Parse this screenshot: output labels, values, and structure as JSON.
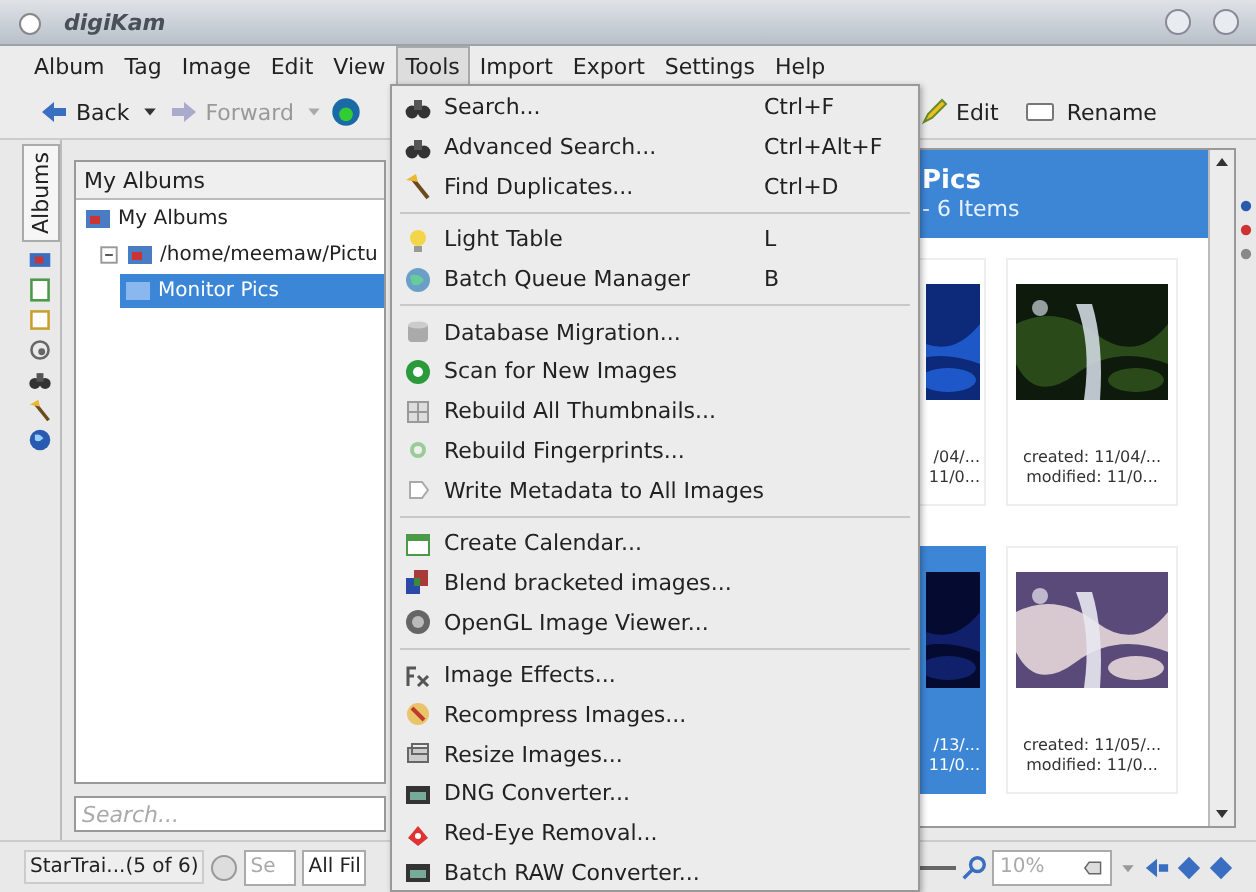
{
  "window": {
    "title": "digiKam"
  },
  "menubar": [
    {
      "label": "Album",
      "selected": false
    },
    {
      "label": "Tag",
      "selected": false
    },
    {
      "label": "Image",
      "selected": false
    },
    {
      "label": "Edit",
      "selected": false
    },
    {
      "label": "View",
      "selected": false
    },
    {
      "label": "Tools",
      "selected": true
    },
    {
      "label": "Import",
      "selected": false
    },
    {
      "label": "Export",
      "selected": false
    },
    {
      "label": "Settings",
      "selected": false
    },
    {
      "label": "Help",
      "selected": false
    }
  ],
  "toolbar": {
    "left": [
      {
        "label": "Back",
        "disabled": false
      },
      {
        "label": "Forward",
        "disabled": true
      }
    ],
    "right": [
      {
        "label": "Edit"
      },
      {
        "label": "Rename"
      }
    ]
  },
  "side_tabs": [
    {
      "label": "Albums",
      "selected": true
    }
  ],
  "album_panel": {
    "header": "My Albums",
    "tree": [
      {
        "label": "My Albums",
        "selected": false,
        "children": [
          {
            "label": "/home/meemaw/Pictu",
            "selected": false,
            "children": [
              {
                "label": "Monitor Pics",
                "selected": true
              }
            ]
          }
        ]
      }
    ],
    "search_placeholder": "Search..."
  },
  "icon_view": {
    "title": "Pics",
    "subtitle": "- 6 Items",
    "rows": [
      [
        {
          "lines": [
            "/04/...",
            "11/0..."
          ],
          "selected": false,
          "partial": true
        },
        {
          "lines": [
            "created: 11/04/...",
            "modified: 11/0..."
          ],
          "selected": false,
          "partial": false
        }
      ],
      [
        {
          "lines": [
            "/13/...",
            "11/0..."
          ],
          "selected": true,
          "partial": true
        },
        {
          "lines": [
            "created: 11/05/...",
            "modified: 11/0..."
          ],
          "selected": false,
          "partial": false
        }
      ]
    ]
  },
  "menu": {
    "groups": [
      [
        {
          "label": "Search...",
          "shortcut": "Ctrl+F"
        },
        {
          "label": "Advanced Search...",
          "shortcut": "Ctrl+Alt+F"
        },
        {
          "label": "Find Duplicates...",
          "shortcut": "Ctrl+D"
        }
      ],
      [
        {
          "label": "Light Table",
          "shortcut": "L"
        },
        {
          "label": "Batch Queue Manager",
          "shortcut": "B"
        }
      ],
      [
        {
          "label": "Database Migration..."
        },
        {
          "label": "Scan for New Images"
        },
        {
          "label": "Rebuild All Thumbnails..."
        },
        {
          "label": "Rebuild Fingerprints..."
        },
        {
          "label": "Write Metadata to All Images"
        }
      ],
      [
        {
          "label": "Create Calendar..."
        },
        {
          "label": "Blend bracketed images..."
        },
        {
          "label": "OpenGL Image Viewer..."
        }
      ],
      [
        {
          "label": "Image Effects..."
        },
        {
          "label": "Recompress Images..."
        },
        {
          "label": "Resize Images..."
        },
        {
          "label": "DNG Converter..."
        },
        {
          "label": "Red-Eye Removal..."
        },
        {
          "label": "Batch RAW Converter..."
        }
      ]
    ]
  },
  "status_bar": {
    "item": "StarTrai...(5 of 6)",
    "search_placeholder": "Se",
    "filter": "All Fil",
    "zoom": "10%"
  }
}
